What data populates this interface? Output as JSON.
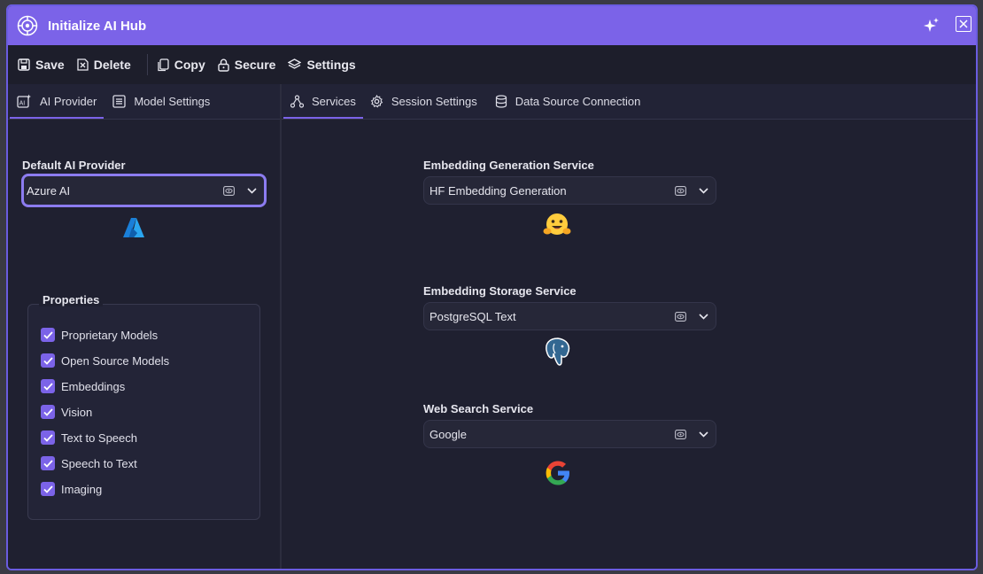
{
  "window": {
    "title": "Initialize AI Hub",
    "accent": "#7b63e8"
  },
  "toolbar": {
    "save_label": "Save",
    "delete_label": "Delete",
    "copy_label": "Copy",
    "secure_label": "Secure",
    "settings_label": "Settings"
  },
  "left_tabs": [
    {
      "label": "AI Provider",
      "active": true
    },
    {
      "label": "Model Settings",
      "active": false
    }
  ],
  "right_tabs": [
    {
      "label": "Services",
      "active": true
    },
    {
      "label": "Session Settings",
      "active": false
    },
    {
      "label": "Data Source Connection",
      "active": false
    }
  ],
  "provider": {
    "label": "Default AI Provider",
    "value": "Azure AI",
    "logo": "azure-logo"
  },
  "properties": {
    "title": "Properties",
    "items": [
      {
        "label": "Proprietary Models",
        "checked": true
      },
      {
        "label": "Open Source Models",
        "checked": true
      },
      {
        "label": "Embeddings",
        "checked": true
      },
      {
        "label": "Vision",
        "checked": true
      },
      {
        "label": "Text to Speech",
        "checked": true
      },
      {
        "label": "Speech to Text",
        "checked": true
      },
      {
        "label": "Imaging",
        "checked": true
      }
    ]
  },
  "services": {
    "embedding_generation": {
      "label": "Embedding Generation Service",
      "value": "HF Embedding Generation",
      "logo": "huggingface-logo"
    },
    "embedding_storage": {
      "label": "Embedding Storage Service",
      "value": "PostgreSQL Text",
      "logo": "postgresql-logo"
    },
    "web_search": {
      "label": "Web Search Service",
      "value": "Google",
      "logo": "google-logo"
    }
  }
}
